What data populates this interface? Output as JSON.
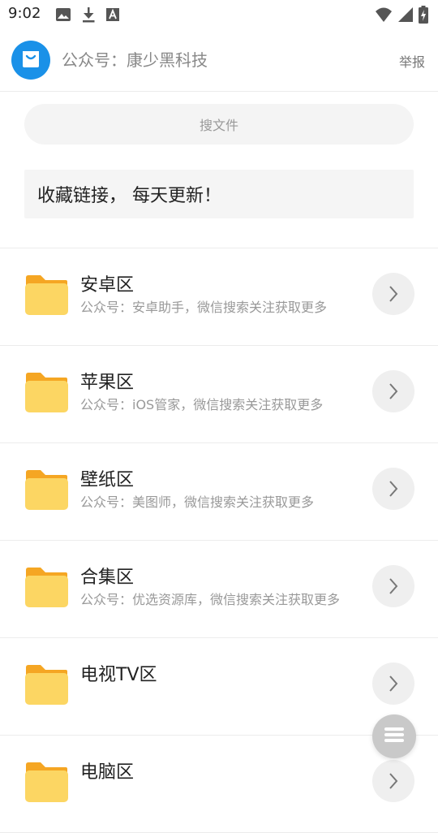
{
  "status_bar": {
    "time": "9:02",
    "left_icons": [
      "image-icon",
      "download-icon",
      "text-a-icon"
    ],
    "right_icons": [
      "wifi-icon",
      "cell-signal-icon",
      "battery-charging-icon"
    ]
  },
  "header": {
    "title": "公众号：康少黑科技",
    "report_label": "举报",
    "avatar_color": "#1a91e8"
  },
  "search": {
    "placeholder": "搜文件"
  },
  "notice": {
    "text": "收藏链接， 每天更新！"
  },
  "folders": [
    {
      "title": "安卓区",
      "subtitle": "公众号：安卓助手，微信搜索关注获取更多"
    },
    {
      "title": "苹果区",
      "subtitle": "公众号：iOS管家，微信搜索关注获取更多"
    },
    {
      "title": "壁纸区",
      "subtitle": "公众号：美图师，微信搜索关注获取更多"
    },
    {
      "title": "合集区",
      "subtitle": "公众号：优选资源库，微信搜索关注获取更多"
    },
    {
      "title": "电视TV区",
      "subtitle": ""
    },
    {
      "title": "电脑区",
      "subtitle": ""
    }
  ],
  "colors": {
    "folder_body": "#fcd663",
    "folder_tab": "#f5a623",
    "chevron_bg": "#efefef",
    "fab_bg": "#c9c9c9"
  }
}
